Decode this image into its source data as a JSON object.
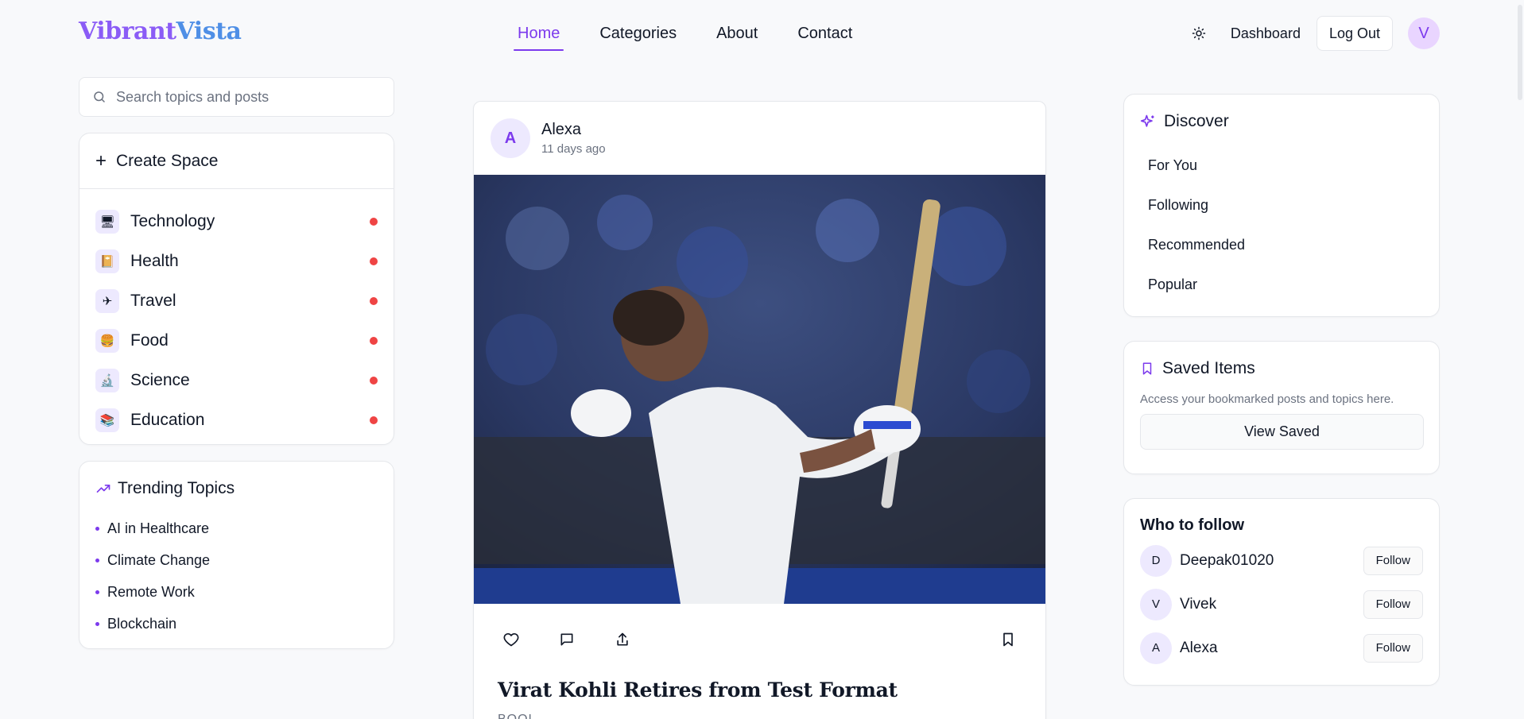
{
  "brand": {
    "part1": "Vibrant",
    "part2": "Vista"
  },
  "nav": [
    {
      "label": "Home",
      "active": true
    },
    {
      "label": "Categories",
      "active": false
    },
    {
      "label": "About",
      "active": false
    },
    {
      "label": "Contact",
      "active": false
    }
  ],
  "header": {
    "theme_icon": "sun-icon",
    "dashboard_label": "Dashboard",
    "logout_label": "Log Out",
    "user_initial": "V"
  },
  "search": {
    "placeholder": "Search topics and posts",
    "value": ""
  },
  "spaces": {
    "create_label": "Create Space",
    "items": [
      {
        "label": "Technology",
        "icon": "🖥"
      },
      {
        "label": "Health",
        "icon": "📔"
      },
      {
        "label": "Travel",
        "icon": "✈"
      },
      {
        "label": "Food",
        "icon": "🍔"
      },
      {
        "label": "Science",
        "icon": "🔬"
      },
      {
        "label": "Education",
        "icon": "📚"
      }
    ]
  },
  "trending": {
    "title": "Trending Topics",
    "items": [
      "AI in Healthcare",
      "Climate Change",
      "Remote Work",
      "Blockchain"
    ]
  },
  "post": {
    "author_initial": "A",
    "author": "Alexa",
    "time": "11 days ago",
    "title": "Virat Kohli Retires from Test Format",
    "tag": "BOOL"
  },
  "discover": {
    "title": "Discover",
    "items": [
      "For You",
      "Following",
      "Recommended",
      "Popular"
    ]
  },
  "saved": {
    "title": "Saved Items",
    "description": "Access your bookmarked posts and topics here.",
    "button_label": "View Saved"
  },
  "who_to_follow": {
    "title": "Who to follow",
    "follow_label": "Follow",
    "users": [
      {
        "initial": "D",
        "name": "Deepak01020"
      },
      {
        "initial": "V",
        "name": "Vivek"
      },
      {
        "initial": "A",
        "name": "Alexa"
      }
    ]
  },
  "colors": {
    "accent": "#7c3aed",
    "brand_purple": "#8b5cf6",
    "brand_blue": "#4f8fe6",
    "dot_red": "#ef4444"
  }
}
